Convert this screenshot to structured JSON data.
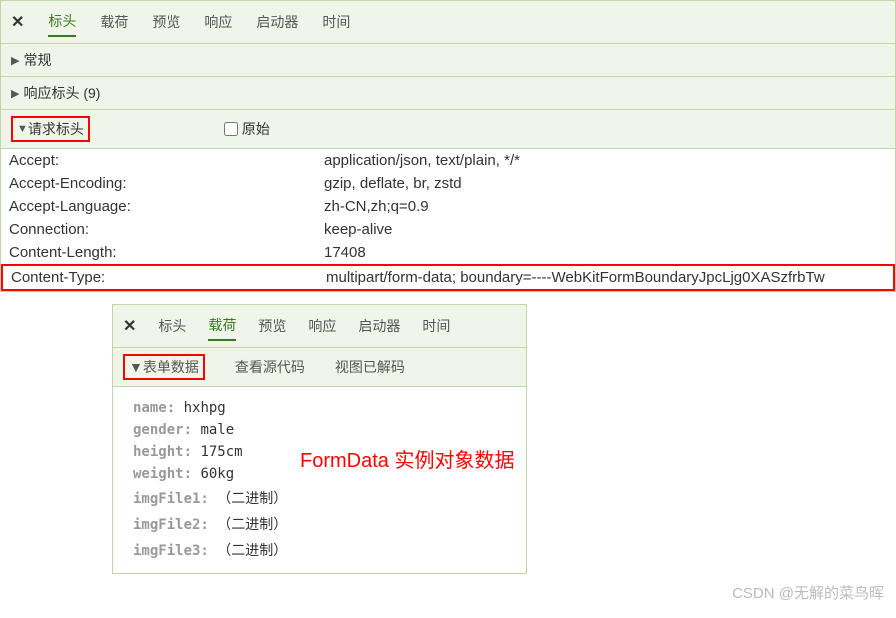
{
  "topPanel": {
    "tabs": [
      "标头",
      "载荷",
      "预览",
      "响应",
      "启动器",
      "时间"
    ],
    "activeTab": 0,
    "sections": {
      "general": "常规",
      "responseHeaders": "响应标头 (9)",
      "requestHeaders": "请求标头",
      "rawLabel": "原始"
    },
    "headers": [
      {
        "key": "Accept:",
        "value": "application/json, text/plain, */*"
      },
      {
        "key": "Accept-Encoding:",
        "value": "gzip, deflate, br, zstd"
      },
      {
        "key": "Accept-Language:",
        "value": "zh-CN,zh;q=0.9"
      },
      {
        "key": "Connection:",
        "value": "keep-alive"
      },
      {
        "key": "Content-Length:",
        "value": "17408"
      },
      {
        "key": "Content-Type:",
        "value": "multipart/form-data; boundary=----WebKitFormBoundaryJpcLjg0XASzfrbTw"
      }
    ]
  },
  "bottomPanel": {
    "tabs": [
      "标头",
      "载荷",
      "预览",
      "响应",
      "启动器",
      "时间"
    ],
    "activeTab": 1,
    "formDataLabel": "表单数据",
    "viewSourceLabel": "查看源代码",
    "viewDecodedLabel": "视图已解码",
    "fields": [
      {
        "key": "name:",
        "value": "hxhpg"
      },
      {
        "key": "gender:",
        "value": "male"
      },
      {
        "key": "height:",
        "value": "175cm"
      },
      {
        "key": "weight:",
        "value": "60kg"
      },
      {
        "key": "imgFile1:",
        "value": "（二进制）"
      },
      {
        "key": "imgFile2:",
        "value": "（二进制）"
      },
      {
        "key": "imgFile3:",
        "value": "（二进制）"
      }
    ],
    "annotation": "FormData 实例对象数据"
  },
  "watermark": "CSDN @无解的菜鸟晖"
}
